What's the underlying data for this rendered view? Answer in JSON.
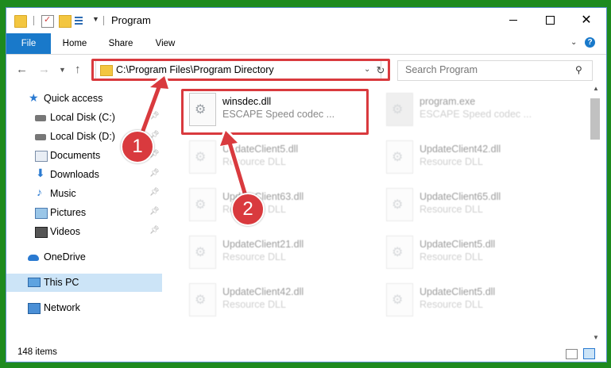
{
  "window": {
    "title": "Program",
    "status": "148 items"
  },
  "ribbon": {
    "tabs": [
      "File",
      "Home",
      "Share",
      "View"
    ],
    "help": "?"
  },
  "address": {
    "path": "C:\\Program Files\\Program Directory"
  },
  "search": {
    "placeholder": "Search Program"
  },
  "sidebar": {
    "items": [
      {
        "label": "Quick access",
        "icon": "star-icon"
      },
      {
        "label": "Local Disk (C:)",
        "icon": "drive-icon"
      },
      {
        "label": "Local Disk (D:)",
        "icon": "drive-icon"
      },
      {
        "label": "Documents",
        "icon": "documents-icon"
      },
      {
        "label": "Downloads",
        "icon": "download-icon"
      },
      {
        "label": "Music",
        "icon": "music-icon"
      },
      {
        "label": "Pictures",
        "icon": "pictures-icon"
      },
      {
        "label": "Videos",
        "icon": "videos-icon"
      },
      {
        "label": "OneDrive",
        "icon": "cloud-icon"
      },
      {
        "label": "This PC",
        "icon": "computer-icon"
      },
      {
        "label": "Network",
        "icon": "network-icon"
      }
    ]
  },
  "files": [
    {
      "name": "winsdec.dll",
      "desc": "ESCAPE Speed codec ..."
    },
    {
      "name": "program.exe",
      "desc": "ESCAPE Speed codec ..."
    },
    {
      "name": "UpdateClient5.dll",
      "desc": "Resource DLL"
    },
    {
      "name": "UpdateClient42.dll",
      "desc": "Resource DLL"
    },
    {
      "name": "UpdateClient63.dll",
      "desc": "Resource DLL"
    },
    {
      "name": "UpdateClient65.dll",
      "desc": "Resource DLL"
    },
    {
      "name": "UpdateClient21.dll",
      "desc": "Resource DLL"
    },
    {
      "name": "UpdateClient5.dll",
      "desc": "Resource DLL"
    },
    {
      "name": "UpdateClient42.dll",
      "desc": "Resource DLL"
    },
    {
      "name": "UpdateClient5.dll",
      "desc": "Resource DLL"
    }
  ],
  "callouts": [
    "1",
    "2"
  ],
  "colors": {
    "accent": "#1979ca",
    "annotation": "#d93a3e",
    "selection": "#cce4f7"
  }
}
